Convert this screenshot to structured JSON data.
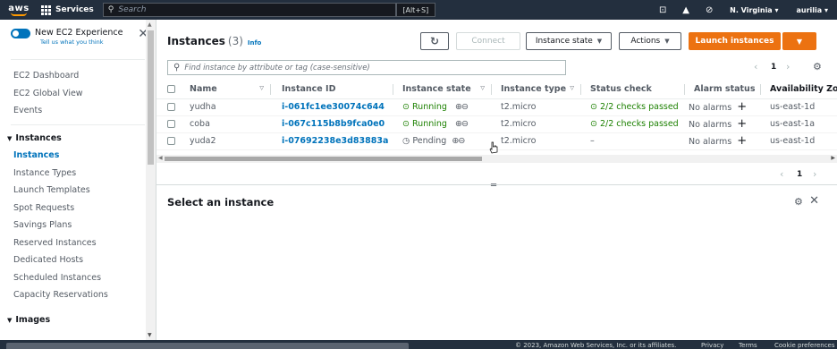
{
  "topnav": {
    "logo": "aws",
    "services_label": "Services",
    "search_placeholder": "Search",
    "shortcut": "[Alt+S]",
    "region": "N. Virginia",
    "account": "aurilia"
  },
  "sidebar": {
    "experience_title": "New EC2 Experience",
    "experience_sub": "Tell us what you think",
    "items_top": [
      "EC2 Dashboard",
      "EC2 Global View",
      "Events"
    ],
    "instances_header": "Instances",
    "instances_items": [
      {
        "label": "Instances",
        "active": true
      },
      {
        "label": "Instance Types",
        "active": false
      },
      {
        "label": "Launch Templates",
        "active": false
      },
      {
        "label": "Spot Requests",
        "active": false
      },
      {
        "label": "Savings Plans",
        "active": false
      },
      {
        "label": "Reserved Instances",
        "active": false
      },
      {
        "label": "Dedicated Hosts",
        "active": false
      },
      {
        "label": "Scheduled Instances",
        "active": false
      },
      {
        "label": "Capacity Reservations",
        "active": false
      }
    ],
    "images_header": "Images"
  },
  "main": {
    "title": "Instances",
    "count": "(3)",
    "info": "Info",
    "connect_label": "Connect",
    "instance_state_label": "Instance state",
    "actions_label": "Actions",
    "launch_label": "Launch instances",
    "filter_placeholder": "Find instance by attribute or tag (case-sensitive)",
    "page": "1",
    "columns": [
      "Name",
      "Instance ID",
      "Instance state",
      "Instance type",
      "Status check",
      "Alarm status",
      "Availability Zone"
    ],
    "rows": [
      {
        "name": "yudha",
        "id": "i-061fc1ee30074c644",
        "state": "Running",
        "type": "t2.micro",
        "status": "2/2 checks passed",
        "alarm": "No alarms",
        "az": "us-east-1d"
      },
      {
        "name": "coba",
        "id": "i-067c115b8b9fca0e0",
        "state": "Running",
        "type": "t2.micro",
        "status": "2/2 checks passed",
        "alarm": "No alarms",
        "az": "us-east-1a"
      },
      {
        "name": "yuda2",
        "id": "i-07692238e3d83883a",
        "state": "Pending",
        "type": "t2.micro",
        "status": "–",
        "alarm": "No alarms",
        "az": "us-east-1d"
      }
    ],
    "detail_page": "1",
    "detail_title": "Select an instance"
  },
  "footer": {
    "copyright": "© 2023, Amazon Web Services, Inc. or its affiliates.",
    "privacy": "Privacy",
    "terms": "Terms",
    "cookie": "Cookie preferences"
  },
  "colors": {
    "nav_bg": "#232f3e",
    "accent": "#ec7211",
    "link": "#0073bb",
    "running": "#1d8102"
  }
}
